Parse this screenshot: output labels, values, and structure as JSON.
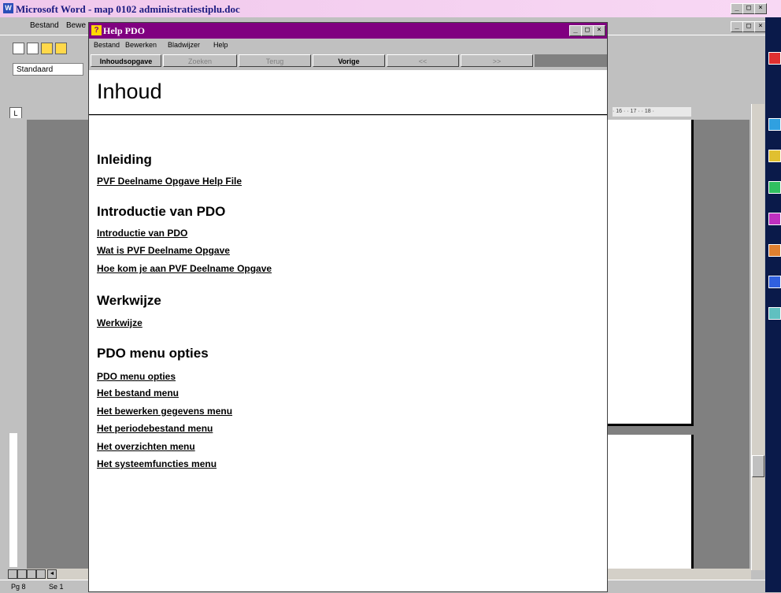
{
  "word": {
    "title": "Microsoft Word - map 0102 administratiestiplu.doc",
    "menu": [
      "Bestand",
      "Bewe"
    ],
    "style_value": "Standaard",
    "status": {
      "page": "Pg 8",
      "section": "Se 1"
    }
  },
  "help": {
    "title": "Help PDO",
    "menu": [
      "Bestand",
      "Bewerken",
      "Bladwijzer",
      "Help"
    ],
    "buttons": [
      {
        "label": "Inhoudsopgave",
        "enabled": true
      },
      {
        "label": "Zoeken",
        "enabled": false
      },
      {
        "label": "Terug",
        "enabled": false
      },
      {
        "label": "Vorige",
        "enabled": true
      },
      {
        "label": "<<",
        "enabled": false
      },
      {
        "label": ">>",
        "enabled": false
      }
    ],
    "heading": "Inhoud",
    "sections": [
      {
        "title": "Inleiding",
        "links": [
          "PVF Deelname Opgave Help File"
        ]
      },
      {
        "title": "Introductie van PDO",
        "links": [
          "Introductie van PDO",
          "Wat is PVF Deelname Opgave",
          "Hoe kom je aan PVF Deelname Opgave"
        ]
      },
      {
        "title": "Werkwijze",
        "links": [
          "Werkwijze"
        ]
      },
      {
        "title": "PDO menu opties",
        "links": [
          "PDO menu opties",
          "Het bestand menu",
          "Het bewerken gegevens menu",
          "Het periodebestand menu",
          "Het overzichten menu",
          "Het systeemfuncties menu"
        ]
      }
    ]
  },
  "colors": {
    "help_titlebar": "#800080",
    "word_titlebar": "#f0c8ec"
  }
}
